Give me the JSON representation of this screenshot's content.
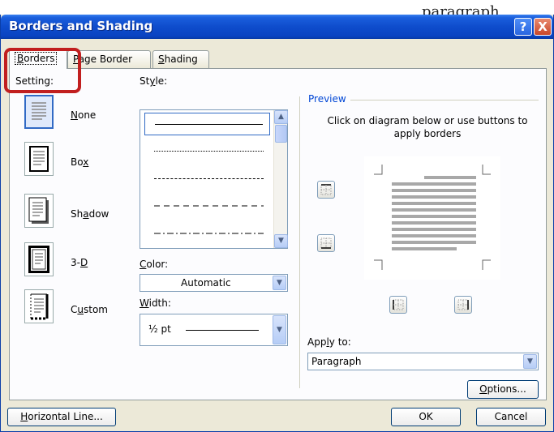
{
  "background": {
    "doc_text": "paragraph"
  },
  "window": {
    "title": "Borders and Shading",
    "help_glyph": "?",
    "close_glyph": "X"
  },
  "tabs": [
    {
      "label": "Borders",
      "mnemonic": "B",
      "rest": "orders"
    },
    {
      "label": "Page Border",
      "mnemonic": "P",
      "rest": "age Border"
    },
    {
      "label": "Shading",
      "mnemonic": "S",
      "rest": "hading"
    }
  ],
  "setting": {
    "label": "Setting:",
    "items": [
      {
        "pre": "",
        "mn": "N",
        "post": "one",
        "full": "None",
        "selected": true
      },
      {
        "pre": "Bo",
        "mn": "x",
        "post": "",
        "full": "Box"
      },
      {
        "pre": "Sh",
        "mn": "a",
        "post": "dow",
        "full": "Shadow"
      },
      {
        "pre": "3-",
        "mn": "D",
        "post": "",
        "full": "3-D"
      },
      {
        "pre": "C",
        "mn": "u",
        "post": "stom",
        "full": "Custom"
      }
    ]
  },
  "style": {
    "label_pre": "St",
    "label_mn": "y",
    "label_post": "le:",
    "label": "Style:"
  },
  "color": {
    "label_mn": "C",
    "label_post": "olor:",
    "label": "Color:",
    "value": "Automatic"
  },
  "width": {
    "label_mn": "W",
    "label_post": "idth:",
    "label": "Width:",
    "value": "½ pt"
  },
  "preview": {
    "legend": "Preview",
    "instruction": "Click on diagram below or use buttons to apply borders"
  },
  "apply_to": {
    "label_pre": "App",
    "label_mn": "l",
    "label_post": "y to:",
    "label": "Apply to:",
    "value": "Paragraph"
  },
  "buttons": {
    "options_mn": "O",
    "options_post": "ptions...",
    "options": "Options...",
    "horizontal_line_mn": "H",
    "horizontal_line_post": "orizontal Line...",
    "horizontal_line": "Horizontal Line...",
    "ok": "OK",
    "cancel": "Cancel"
  },
  "colors": {
    "title_bar": "#0e4ccc",
    "dialog_bg": "#ece9d8",
    "highlight": "#c11f1f",
    "accent": "#316ac5"
  }
}
